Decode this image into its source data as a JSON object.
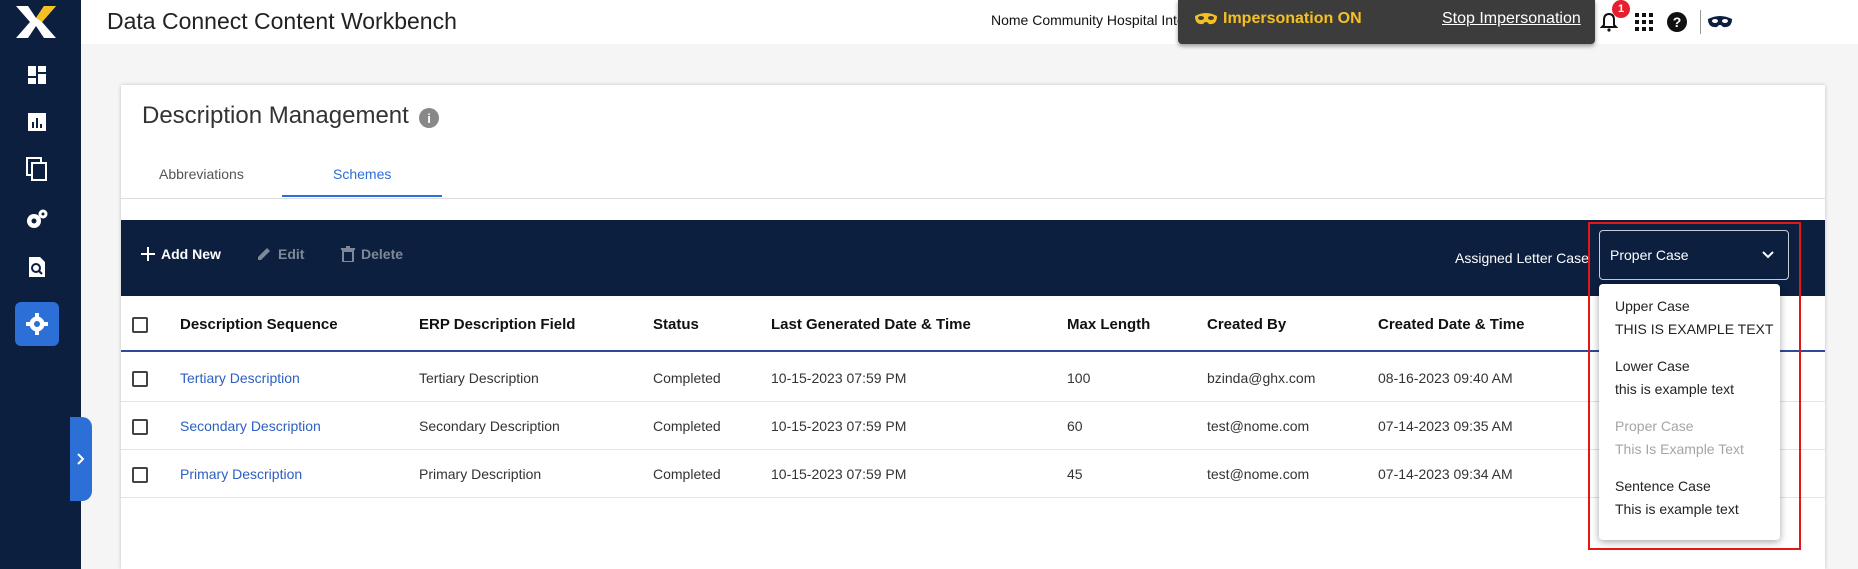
{
  "header": {
    "app_title": "Data Connect Content Workbench",
    "org_name": "Nome Community Hospital Integrated IDN",
    "impersonation_status": "Impersonation ON",
    "stop_impersonation": "Stop Impersonation",
    "notification_count": "1"
  },
  "sidebar": {
    "items": [
      {
        "icon": "dashboard-icon"
      },
      {
        "icon": "reports-icon"
      },
      {
        "icon": "content-copy-icon"
      },
      {
        "icon": "settings-gears-icon"
      },
      {
        "icon": "document-search-icon"
      },
      {
        "icon": "settings-icon",
        "active": true
      }
    ]
  },
  "page": {
    "title": "Description Management",
    "tabs": [
      {
        "label": "Abbreviations",
        "active": false
      },
      {
        "label": "Schemes",
        "active": true
      }
    ]
  },
  "toolbar": {
    "add_label": "Add New",
    "edit_label": "Edit",
    "delete_label": "Delete",
    "assigned_letter_case_label": "Assigned Letter Case",
    "selected_case": "Proper Case"
  },
  "table": {
    "columns": [
      "Description Sequence",
      "ERP Description Field",
      "Status",
      "Last Generated Date & Time",
      "Max Length",
      "Created By",
      "Created Date & Time"
    ],
    "rows": [
      [
        "Tertiary Description",
        "Tertiary Description",
        "Completed",
        "10-15-2023 07:59 PM",
        "100",
        "bzinda@ghx.com",
        "08-16-2023 09:40 AM"
      ],
      [
        "Secondary Description",
        "Secondary Description",
        "Completed",
        "10-15-2023 07:59 PM",
        "60",
        "test@nome.com",
        "07-14-2023 09:35 AM"
      ],
      [
        "Primary Description",
        "Primary Description",
        "Completed",
        "10-15-2023 07:59 PM",
        "45",
        "test@nome.com",
        "07-14-2023 09:34 AM"
      ]
    ]
  },
  "case_menu": {
    "options": [
      {
        "title": "Upper Case",
        "example": "THIS IS EXAMPLE TEXT",
        "disabled": false
      },
      {
        "title": "Lower Case",
        "example": "this is example text",
        "disabled": false
      },
      {
        "title": "Proper Case",
        "example": "This Is Example Text",
        "disabled": true
      },
      {
        "title": "Sentence Case",
        "example": "This is example text",
        "disabled": false
      }
    ]
  },
  "colors": {
    "navy": "#0c1f3f",
    "accent_blue": "#2c6fd6",
    "impersonation_yellow": "#f5c022",
    "highlight_red": "#e21818"
  }
}
